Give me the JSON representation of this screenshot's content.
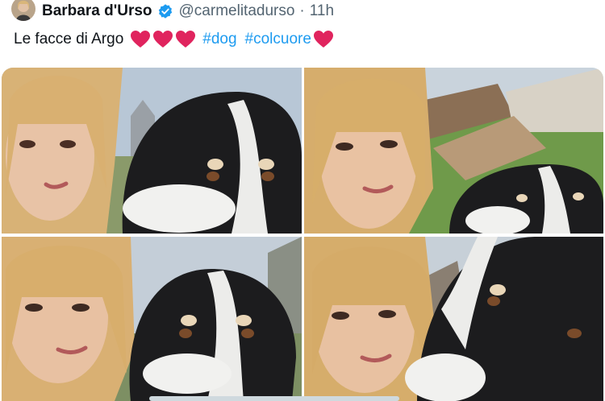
{
  "tweet": {
    "author_name": "Barbara d'Urso",
    "handle": "@carmelitadurso",
    "separator": "·",
    "time": "11h",
    "text_plain": "Le facce di Argo",
    "hashtags": [
      "#dog",
      "#colcuore"
    ]
  },
  "icons": {
    "verified": "verified-badge-icon",
    "heart": "red-heart-emoji"
  },
  "colors": {
    "link": "#1d9bf0",
    "verified": "#1d9bf0",
    "heart": "#e0245e",
    "muted": "#536471"
  }
}
